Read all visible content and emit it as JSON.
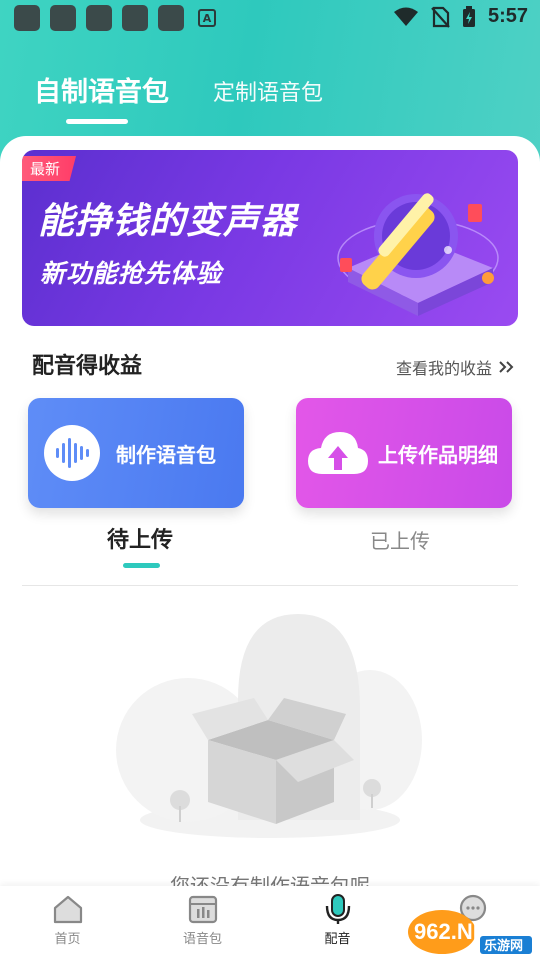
{
  "status_bar": {
    "time": "5:57",
    "app_icon_letter": "A"
  },
  "top_tabs": {
    "active": "自制语音包",
    "inactive": "定制语音包"
  },
  "banner": {
    "tag": "最新",
    "title": "能挣钱的变声器",
    "subtitle": "新功能抢先体验"
  },
  "earnings": {
    "title": "配音得收益",
    "link": "查看我的收益"
  },
  "actions": {
    "make": "制作语音包",
    "upload": "上传作品明细"
  },
  "sub_tabs": {
    "pending": "待上传",
    "uploaded": "已上传"
  },
  "empty_message": "您还没有制作语音包呢",
  "bottom_nav": [
    {
      "label": "首页",
      "icon": "home-icon"
    },
    {
      "label": "语音包",
      "icon": "voice-pack-icon"
    },
    {
      "label": "配音",
      "icon": "microphone-icon",
      "active": true
    },
    {
      "label": "",
      "icon": "chat-icon"
    }
  ],
  "watermark": {
    "text": "962.NET",
    "sub": "乐游网"
  },
  "colors": {
    "accent": "#2ec9bd",
    "make_button": "#4a79f0",
    "upload_button": "#c94ae8",
    "banner": "#7a39e4"
  }
}
